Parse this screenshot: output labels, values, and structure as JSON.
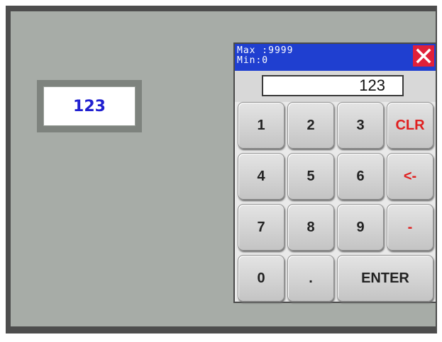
{
  "numeric_field": {
    "value": "123"
  },
  "keypad": {
    "max_label": "Max :9999",
    "min_label": "Min:0",
    "close_icon": "close-icon",
    "display_value": "123",
    "keys": {
      "k1": "1",
      "k2": "2",
      "k3": "3",
      "clr": "CLR",
      "k4": "4",
      "k5": "5",
      "k6": "6",
      "backspace": "<-",
      "k7": "7",
      "k8": "8",
      "k9": "9",
      "minus": "-",
      "k0": "0",
      "dot": ".",
      "enter": "ENTER"
    }
  },
  "colors": {
    "screen_bg": "#a7aca7",
    "title_bar": "#1f3fd0",
    "close_button": "#e0203a",
    "field_text": "#2020d0",
    "accent_red_text": "#e02020"
  }
}
